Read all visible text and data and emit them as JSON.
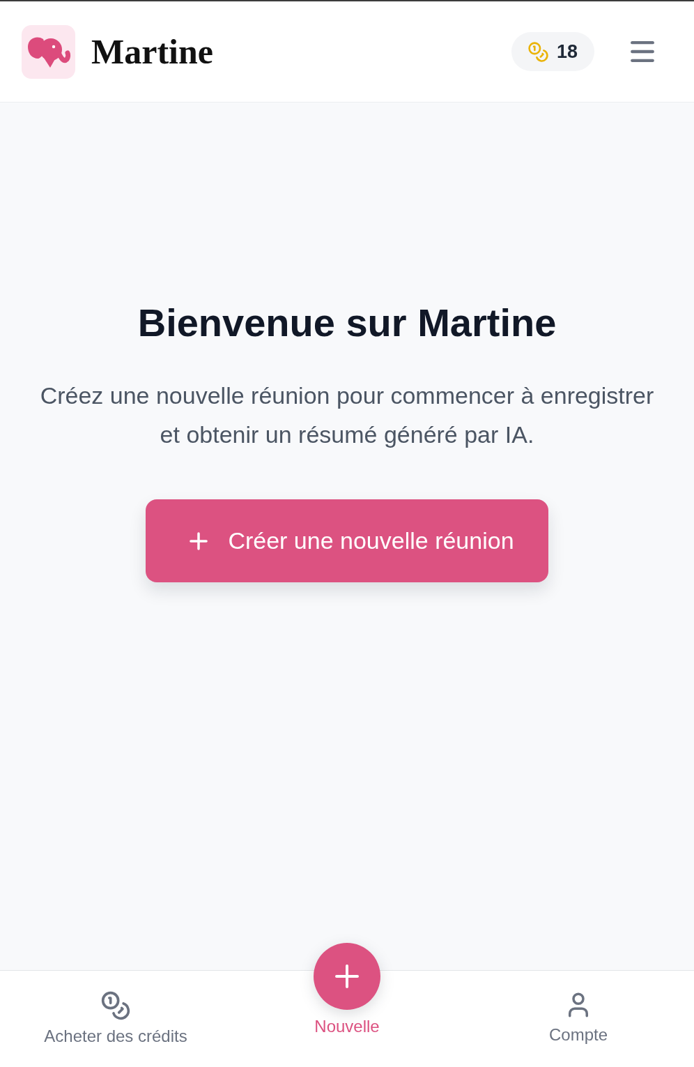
{
  "header": {
    "app_name": "Martine",
    "credits": {
      "count": "18"
    }
  },
  "welcome": {
    "title": "Bienvenue sur Martine",
    "text": "Créez une nouvelle réunion pour commencer à enregistrer et obtenir un résumé généré par IA.",
    "button": "Créer une nouvelle réunion"
  },
  "bottom_nav": [
    {
      "kind": "link",
      "label": "Acheter des crédits"
    },
    {
      "kind": "fab",
      "label": "Nouvelle"
    },
    {
      "kind": "link",
      "label": "Compte"
    }
  ]
}
